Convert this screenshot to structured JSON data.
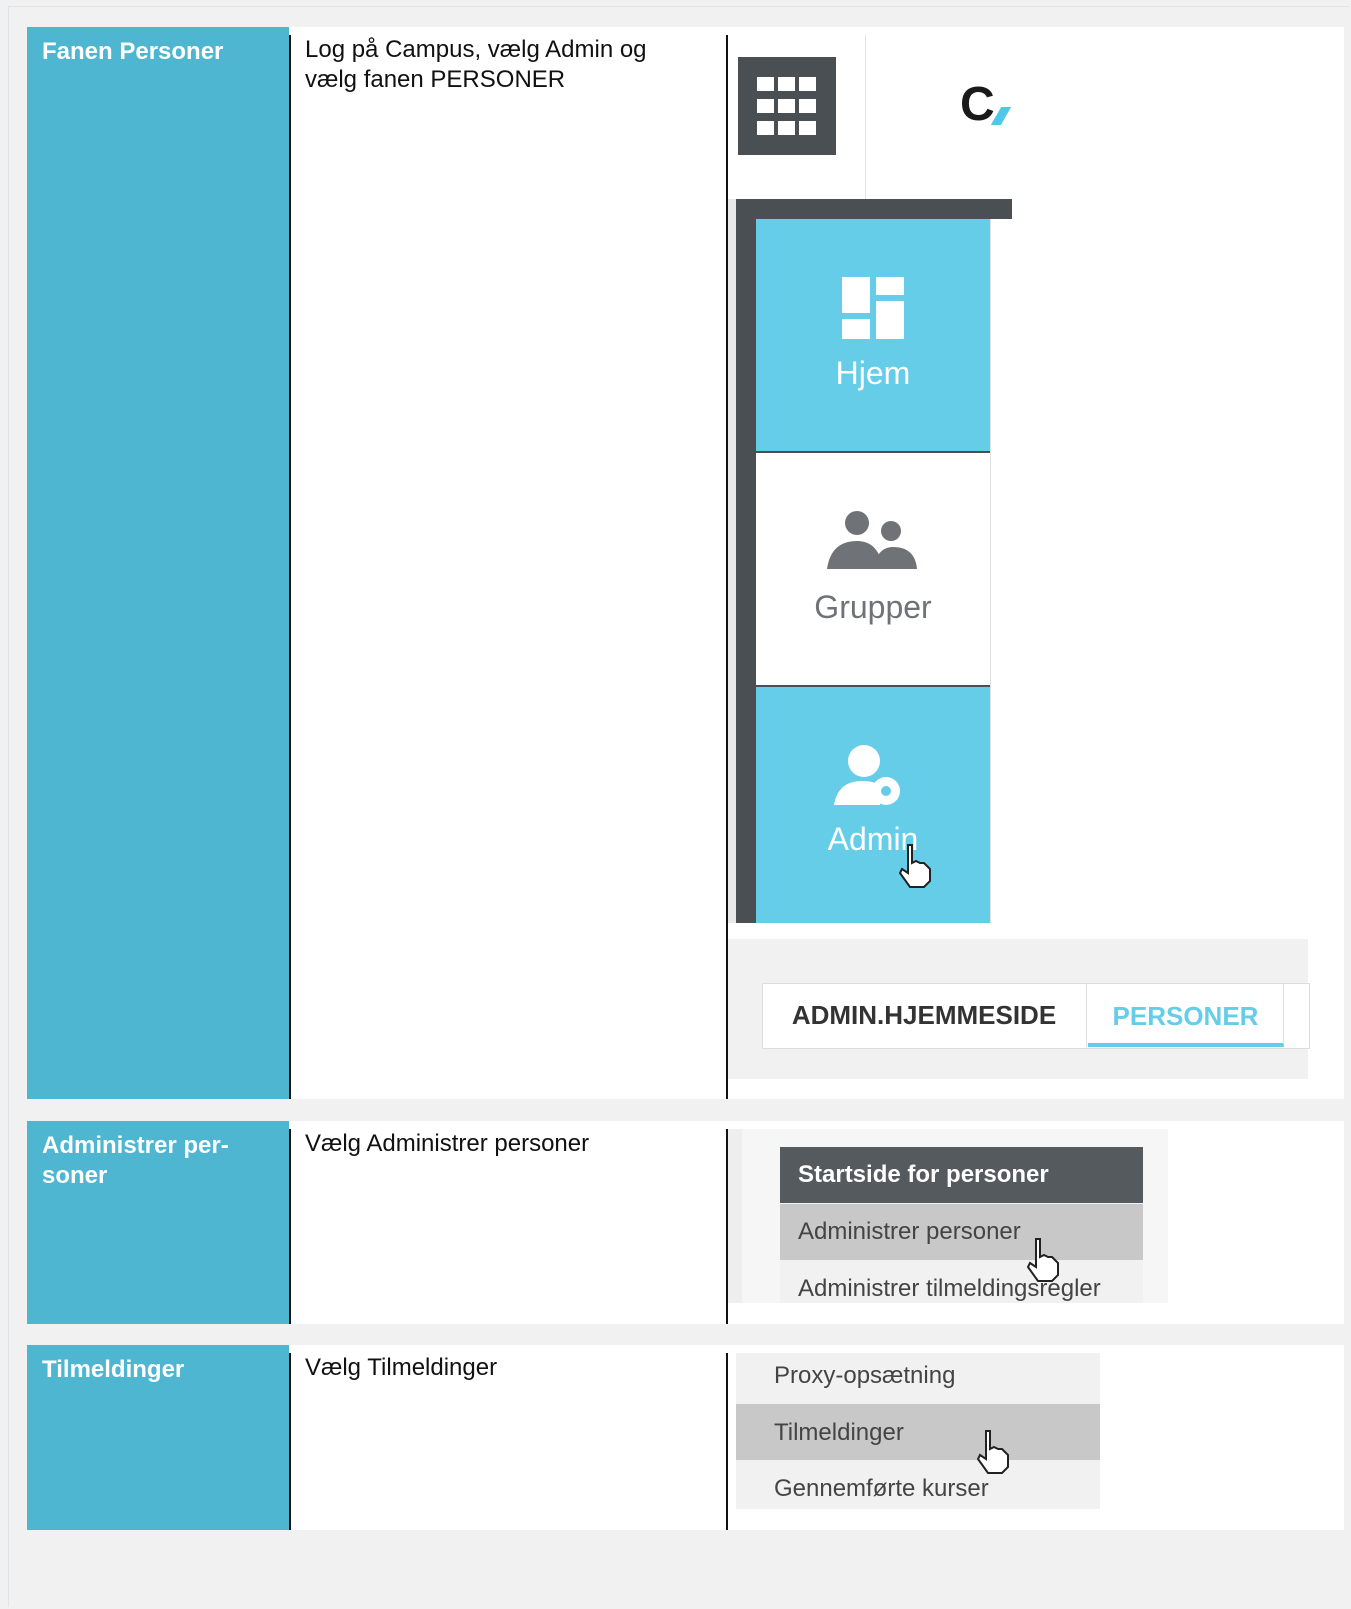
{
  "rows": [
    {
      "label": "Fanen Personer",
      "description": "Log på Campus, vælg Admin og vælg fanen PERSONER"
    },
    {
      "label": "Administrer per-soner",
      "description": "Vælg Administrer personer"
    },
    {
      "label": "Tilmeldinger",
      "description": "Vælg Tilmeldinger"
    }
  ],
  "shot1": {
    "logo_text": "C",
    "tiles": {
      "home": "Hjem",
      "groups": "Grupper",
      "admin": "Admin"
    },
    "tabs": {
      "admin_home": "ADMIN.HJEMMESIDE",
      "persons": "PERSONER"
    },
    "colors": {
      "accent": "#66cde8",
      "dark": "#4a4f54",
      "label_bg": "#4fb6d1"
    }
  },
  "shot2": {
    "header": "Startside for personer",
    "item_selected": "Administrer personer",
    "item_next": "Administrer tilmeldingsregler"
  },
  "shot3": {
    "item_prev": "Proxy-opsætning",
    "item_selected": "Tilmeldinger",
    "item_next": "Gennemførte kurser"
  }
}
